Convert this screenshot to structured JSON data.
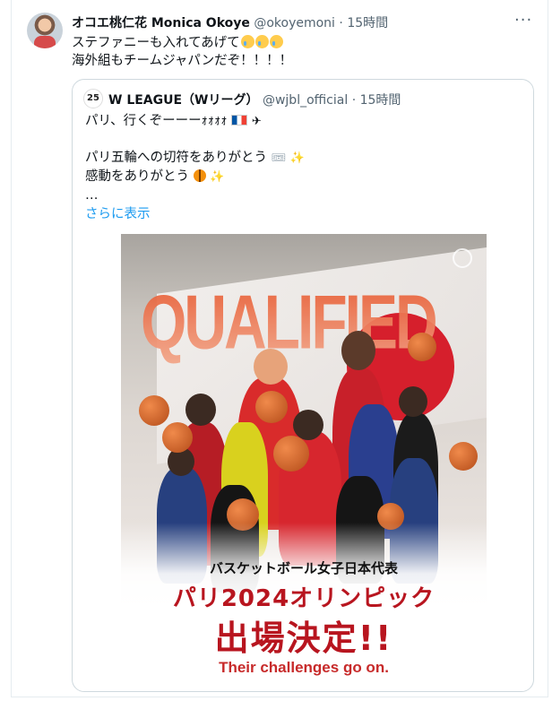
{
  "tweet": {
    "author_name": "オコエ桃仁花 Monica Okoye",
    "author_handle": "@okoyemoni",
    "separator": "·",
    "time": "15時間",
    "line1": "ステファニーも入れてあげて",
    "line2": "海外組もチームジャパンだぞ！！！！",
    "more_icon": "more-horizontal-icon"
  },
  "quoted": {
    "avatar_text": "25",
    "author_name": "W LEAGUE（Wリーグ）",
    "author_handle": "@wjbl_official",
    "separator": "·",
    "time": "15時間",
    "line1": "パリ、行くぞーーーｫｫｫｫ",
    "line2": "パリ五輪への切符をありがとう",
    "line3": "感動をありがとう",
    "ellipsis": "…",
    "show_more": "さらに表示"
  },
  "poster": {
    "headline": "QUALIFIED",
    "subtitle": "バスケットボール女子日本代表",
    "main": "パリ2024オリンピック",
    "big": "出場決定!!",
    "english": "Their challenges go on.",
    "colors": {
      "accent_red": "#b8151f",
      "flag_red": "#d61f2c",
      "orange": "#e7552b"
    }
  },
  "colors": {
    "link": "#1d9bf0",
    "muted": "#536471",
    "border": "#cfd9de"
  }
}
